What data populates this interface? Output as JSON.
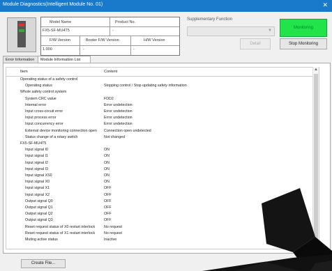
{
  "window": {
    "title": "Module Diagnostics(Intelligent Module No. 01)",
    "close_icon": "close-icon"
  },
  "module_table": {
    "model_name_label": "Model Name",
    "product_no_label": "Product No.",
    "model_name_value": "FX5-SF-MU4T5",
    "product_no_value": "-",
    "fw_version_label": "F/W Version",
    "booter_fw_version_label": "Booter F/W Version",
    "hw_version_label": "H/W Version",
    "fw_version_value": "1.000",
    "booter_fw_version_value": "-",
    "hw_version_value": "-"
  },
  "supplementary": {
    "label": "Supplementary Function",
    "select_value": "",
    "detail_button": "Detail",
    "arrow_icon": "chevron-down-icon"
  },
  "monitor": {
    "status_button": "Monitoring",
    "stop_button": "Stop Monitoring",
    "status_color": "#23e34a"
  },
  "tabs": [
    {
      "label": "Error Information"
    },
    {
      "label": "Module Information List"
    }
  ],
  "list": {
    "col_item": "Item",
    "col_content": "Content",
    "rows": [
      {
        "item": "Operating status of a safety control",
        "content": ""
      },
      {
        "item": "Operating status",
        "content": "Stopping control / Stop updating safety information"
      },
      {
        "item": "Whole safety control system",
        "content": ""
      },
      {
        "item": "System CRC value",
        "content": "FDD2"
      },
      {
        "item": "Internal error",
        "content": "Error undetection"
      },
      {
        "item": "Input cross-circuit error",
        "content": "Error undetection"
      },
      {
        "item": "Input process error",
        "content": "Error undetection"
      },
      {
        "item": "Input concurrency error",
        "content": "Error undetection"
      },
      {
        "item": "External device monitoring connection open",
        "content": "Connection open undetected"
      },
      {
        "item": "Status change of a rotary switch",
        "content": "Not changed"
      },
      {
        "item": "FX5-SF-MU4T5",
        "content": ""
      },
      {
        "item": "Input signal I0",
        "content": "ON"
      },
      {
        "item": "Input signal I1",
        "content": "ON"
      },
      {
        "item": "Input signal I2",
        "content": "ON"
      },
      {
        "item": "Input signal I3",
        "content": "ON"
      },
      {
        "item": "Input signal XS0",
        "content": "ON"
      },
      {
        "item": "Input signal X0",
        "content": "ON"
      },
      {
        "item": "Input signal X1",
        "content": "OFF"
      },
      {
        "item": "Input signal X2",
        "content": "OFF"
      },
      {
        "item": "Output signal Q0",
        "content": "OFF"
      },
      {
        "item": "Output signal Q1",
        "content": "OFF"
      },
      {
        "item": "Output signal Q2",
        "content": "OFF"
      },
      {
        "item": "Output signal Q3",
        "content": "OFF"
      },
      {
        "item": "Reset request status of X0 restart interlock",
        "content": "No request"
      },
      {
        "item": "Reset request status of X1 restart interlock",
        "content": "No request"
      },
      {
        "item": "Muting active status",
        "content": "Inactive"
      }
    ]
  },
  "footer": {
    "create_file_button": "Create File..."
  }
}
